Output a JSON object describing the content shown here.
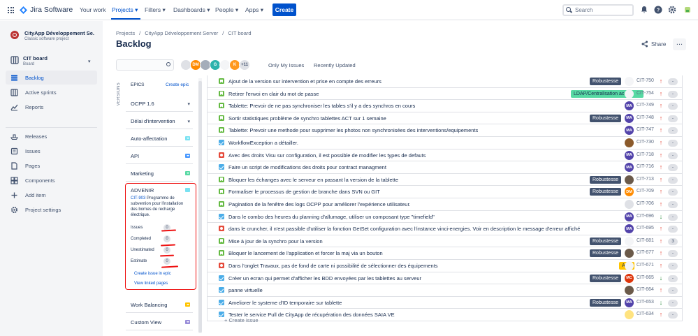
{
  "topnav": {
    "logo": "Jira Software",
    "items": [
      "Your work",
      "Projects",
      "Filters",
      "Dashboards",
      "People",
      "Apps"
    ],
    "create_label": "Create",
    "search_placeholder": "Search"
  },
  "sidebar": {
    "project_name": "CityApp Développement Se...",
    "project_type": "Classic software project",
    "board_name": "CIT board",
    "board_sub": "Board",
    "items": [
      "Backlog",
      "Active sprints",
      "Reports",
      "Releases",
      "Issues",
      "Pages",
      "Components",
      "Add item",
      "Project settings"
    ]
  },
  "breadcrumb": [
    "Projects",
    "/",
    "CityApp Développement Server",
    "/",
    "CIT board"
  ],
  "page_title": "Backlog",
  "header": {
    "share": "Share",
    "more": "..."
  },
  "filters": {
    "avatars": [
      {
        "text": "",
        "color": "#dfe1e6",
        "icon": "cityapp-logo"
      },
      {
        "text": "DM",
        "color": "#ff8b00"
      },
      {
        "text": "",
        "color": "#a5adba"
      },
      {
        "text": "G",
        "color": "#2cb3ad"
      },
      {
        "text": "",
        "color": "#f4f5f7",
        "icon": "crown-avatar"
      },
      {
        "text": "K",
        "color": "#ff991f"
      },
      {
        "text": "+11",
        "color": "#dfe1e6"
      }
    ],
    "only_my_issues": "Only My Issues",
    "recently_updated": "Recently Updated"
  },
  "epic_panel": {
    "versions_tab": "VERSIONS",
    "header": "EPICS",
    "create_epic": "Create epic",
    "epics": [
      {
        "name": "OCPP 1.6",
        "color": "#42526e",
        "kind": "chevron"
      },
      {
        "name": "Délai d'intervention",
        "color": "#42526e",
        "kind": "chevron"
      },
      {
        "name": "Auto-affectation",
        "color": "#79e2f2",
        "kind": "box"
      },
      {
        "name": "API",
        "color": "#4c9aff",
        "kind": "box"
      },
      {
        "name": "Marketing",
        "color": "#57d9a3",
        "kind": "box"
      }
    ],
    "advenir": {
      "name": "ADVENIR",
      "color": "#79e2f2",
      "key": "CIT-903",
      "description": "Programme de subvention pour l'installation des bornes de recharge électrique.",
      "stats": [
        {
          "label": "Issues",
          "value": "0"
        },
        {
          "label": "Completed",
          "value": "0"
        },
        {
          "label": "Unestimated",
          "value": "0"
        },
        {
          "label": "Estimate",
          "value": "0"
        }
      ],
      "create_issue": "Create issue in epic",
      "view_linked": "View linked pages"
    },
    "bottom_epics": [
      {
        "name": "Work Balancing",
        "color": "#ffc400"
      },
      {
        "name": "Custom View",
        "color": "#998dd9"
      }
    ]
  },
  "issues": [
    {
      "type": "story",
      "summary": "Ajout de la version sur intervention et prise en compte des erreurs",
      "label": "Robustesse",
      "label_type": "robust",
      "assignee": "",
      "assignee_color": "#f4f5f7",
      "key": "CIT-750",
      "priority": "up",
      "estimate": "-"
    },
    {
      "type": "story",
      "summary": "Retirer l'envoi en clair du mot de passe",
      "label": "LDAP/Centralisation ac...",
      "label_type": "ldap",
      "assignee": "",
      "assignee_color": "#f4f5f7",
      "key": "CIT-754",
      "priority": "up",
      "estimate": "-"
    },
    {
      "type": "story",
      "summary": "Tablette: Prevoir de ne pas synchroniser les tables s'il y a des synchros en cours",
      "label": "",
      "label_type": "",
      "assignee": "MA",
      "assignee_color": "#5243aa",
      "key": "CIT-749",
      "priority": "up",
      "estimate": "-"
    },
    {
      "type": "story",
      "summary": "Sortir statistiques problème de synchro tablettes ACT sur 1 semaine",
      "label": "Robustesse",
      "label_type": "robust",
      "assignee": "MA",
      "assignee_color": "#5243aa",
      "key": "CIT-748",
      "priority": "up",
      "estimate": "-"
    },
    {
      "type": "story",
      "summary": "Tablette: Prevoir une methode pour supprimer les photos non synchronisées des interventions/equipements",
      "label": "",
      "label_type": "",
      "assignee": "MA",
      "assignee_color": "#5243aa",
      "key": "CIT-747",
      "priority": "up",
      "estimate": "-"
    },
    {
      "type": "task",
      "summary": "WorkflowException a détailler.",
      "label": "",
      "label_type": "",
      "assignee": "",
      "assignee_color": "#8b5a2b",
      "key": "CIT-730",
      "priority": "up",
      "estimate": "-"
    },
    {
      "type": "bug",
      "summary": "Avec des droits Visu sur configuration, il est possible de modifier les types de defauts",
      "label": "",
      "label_type": "",
      "assignee": "MA",
      "assignee_color": "#5243aa",
      "key": "CIT-718",
      "priority": "up",
      "estimate": "-"
    },
    {
      "type": "task",
      "summary": "Faire un script de modifications des droits pour contract managment",
      "label": "",
      "label_type": "",
      "assignee": "MA",
      "assignee_color": "#5243aa",
      "key": "CIT-716",
      "priority": "up",
      "estimate": "-"
    },
    {
      "type": "story",
      "summary": "Bloquer les échanges avec le serveur en passant la version de la tablette",
      "label": "Robustesse",
      "label_type": "robust",
      "assignee": "",
      "assignee_color": "#6b5a4a",
      "key": "CIT-713",
      "priority": "up",
      "estimate": "-"
    },
    {
      "type": "story",
      "summary": "Formaliser le processus de gestion de branche dans SVN ou GIT",
      "label": "Robustesse",
      "label_type": "robust",
      "assignee": "DM",
      "assignee_color": "#ff8b00",
      "key": "CIT-709",
      "priority": "up",
      "estimate": "-"
    },
    {
      "type": "story",
      "summary": "Pagination de la fenêtre des logs OCPP pour améliorer l'expérience utilisateur.",
      "label": "",
      "label_type": "",
      "assignee": "",
      "assignee_color": "#dfe1e6",
      "key": "CIT-706",
      "priority": "up",
      "estimate": "-"
    },
    {
      "type": "task",
      "summary": "Dans le combo des heures du planning d'allumage, utiliser un composant type \"timefield\"",
      "label": "",
      "label_type": "",
      "assignee": "MA",
      "assignee_color": "#5243aa",
      "key": "CIT-696",
      "priority": "down",
      "estimate": "-"
    },
    {
      "type": "bug",
      "summary": "dans le cruncher, il n'est passible d'utiliser la fonction GetSet configuration avec l'instance vinci-energies. Voir en description le message d'erreur affiché",
      "label": "",
      "label_type": "",
      "assignee": "MA",
      "assignee_color": "#5243aa",
      "key": "CIT-695",
      "priority": "up",
      "estimate": "-"
    },
    {
      "type": "story",
      "summary": "Mise à jour de la synchro pour la version",
      "label": "Robustesse",
      "label_type": "robust",
      "assignee": "",
      "assignee_color": "#f4f5f7",
      "key": "CIT-681",
      "priority": "up",
      "estimate": "3"
    },
    {
      "type": "story",
      "summary": "Bloquer le lancement de l'application et forcer la maj via un bouton",
      "label": "Robustesse",
      "label_type": "robust",
      "assignee": "",
      "assignee_color": "#6b5a4a",
      "key": "CIT-677",
      "priority": "up",
      "estimate": "-"
    },
    {
      "type": "bug",
      "summary": "Dans l'onglet Travaux, pas de fond de carte ni possibilité de sélectionner des équipements",
      "label": "ACT",
      "label_type": "act",
      "assignee": "",
      "assignee_color": "#f4f5f7",
      "key": "CIT-671",
      "priority": "up",
      "estimate": "-"
    },
    {
      "type": "task",
      "summary": "Créer un ecran qui permet d'afficher les BDD envoyées par les tablettes au serveur",
      "label": "Robustesse",
      "label_type": "robust",
      "assignee": "MC",
      "assignee_color": "#de350b",
      "key": "CIT-665",
      "priority": "down",
      "estimate": "-"
    },
    {
      "type": "task",
      "summary": "panne virtuelle",
      "label": "",
      "label_type": "",
      "assignee": "",
      "assignee_color": "#6b5a4a",
      "key": "CIT-664",
      "priority": "up",
      "estimate": "-"
    },
    {
      "type": "task",
      "summary": "Ameliorer le systeme d'ID temporaire sur tablette",
      "label": "Robustesse",
      "label_type": "robust",
      "assignee": "MA",
      "assignee_color": "#5243aa",
      "key": "CIT-653",
      "priority": "down",
      "estimate": "-"
    },
    {
      "type": "task",
      "summary": "Tester le service Pull de CityApp de récupération des données SAIA VE",
      "label": "",
      "label_type": "",
      "assignee": "",
      "assignee_color": "#ffe380",
      "key": "CIT-634",
      "priority": "up",
      "estimate": "-"
    }
  ],
  "create_issue": "+ Create issue"
}
